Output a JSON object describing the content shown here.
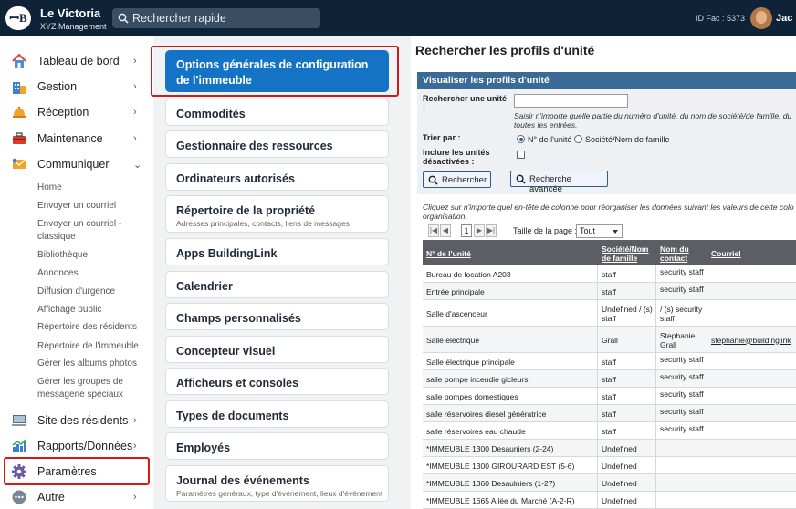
{
  "header": {
    "logo_text": "ꟷB",
    "building_name": "Le Victoria",
    "building_sub": "XYZ Management",
    "search_placeholder": "Rechercher rapide",
    "id_fac": "ID Fac : 5373",
    "user": "Jac"
  },
  "sidebar": {
    "items": [
      {
        "label": "Tableau de bord",
        "icon": "house-icon",
        "chev": "›"
      },
      {
        "label": "Gestion",
        "icon": "building-icon",
        "chev": "›"
      },
      {
        "label": "Réception",
        "icon": "bell-icon",
        "chev": "›"
      },
      {
        "label": "Maintenance",
        "icon": "toolbox-icon",
        "chev": "›"
      },
      {
        "label": "Communiquer",
        "icon": "envelope-icon",
        "chev": "⌄"
      },
      {
        "label": "Site des résidents",
        "icon": "monitor-icon",
        "chev": "›"
      },
      {
        "label": "Rapports/Données",
        "icon": "bar-chart-icon",
        "chev": "›"
      },
      {
        "label": "Paramètres",
        "icon": "gear-icon",
        "chev": ""
      },
      {
        "label": "Autre",
        "icon": "more-icon",
        "chev": "›"
      }
    ],
    "sub_items": [
      "Home",
      "Envoyer un courriel",
      "Envoyer un courriel - classique",
      "Bibliothèque",
      "Annonces",
      "Diffusion d'urgence",
      "Affichage public",
      "Répertoire des résidents",
      "Répertoire de l'immeuble",
      "Gérer les albums photos",
      "Gérer les groupes de messagerie spéciaux"
    ]
  },
  "cards": [
    {
      "title": "Options générales de configuration de l'immeuble",
      "sub": ""
    },
    {
      "title": "Commodités",
      "sub": ""
    },
    {
      "title": "Gestionnaire des ressources",
      "sub": ""
    },
    {
      "title": "Ordinateurs autorisés",
      "sub": ""
    },
    {
      "title": "Répertoire de la propriété",
      "sub": "Adresses principales, contacts, liens de messages"
    },
    {
      "title": "Apps BuildingLink",
      "sub": ""
    },
    {
      "title": "Calendrier",
      "sub": ""
    },
    {
      "title": "Champs personnalisés",
      "sub": ""
    },
    {
      "title": "Concepteur visuel",
      "sub": ""
    },
    {
      "title": "Afficheurs et consoles",
      "sub": ""
    },
    {
      "title": "Types de documents",
      "sub": ""
    },
    {
      "title": "Employés",
      "sub": ""
    },
    {
      "title": "Journal des événements",
      "sub": "Paramètres généraux, type d'événement, lieux d'événement"
    }
  ],
  "main": {
    "page_title": "Rechercher les profils d'unité",
    "panel_title": "Visualiser les profils d'unité",
    "search_label": "Rechercher une unité :",
    "search_value": "",
    "search_hint": "Saisir n'importe quelle partie du numéro d'unité, du nom de société/de famille, du toutes les entrées.",
    "sort_label": "Trier par :",
    "sort_option_1": "N° de l'unité",
    "sort_option_2": "Société/Nom de famille",
    "sort_selected": "N° de l'unité",
    "include_label": "Inclure les unités désactivées :",
    "include_checked": false,
    "search_button": "Rechercher",
    "adv_button": "Recherche avancée",
    "table_hint": "Cliquez sur n'importe quel en-tête de colonne pour réorganiser les données suivant les valeurs de cette colo organisation.",
    "page_number": "1",
    "page_size_label": "Taille de la page :",
    "page_size_value": "Tout",
    "pager_first": "|◀",
    "pager_prev": "◀",
    "pager_next": "▶",
    "pager_last": "▶|"
  },
  "table": {
    "headers": [
      "N° de l'unité",
      "Société/Nom de famille",
      "Nom du contact",
      "Courriel"
    ],
    "rows": [
      [
        "Bureau de location A203",
        "staff",
        "security staff",
        ""
      ],
      [
        "Entrée principale",
        "staff",
        "security staff",
        ""
      ],
      [
        "Salle d'ascenceur",
        "Undefined / (s) staff",
        "/ (s) security staff",
        ""
      ],
      [
        "Salle électrique",
        "Grall",
        "Stephanie Grall",
        "stephanie@buildinglink"
      ],
      [
        "Salle électrique principale",
        "staff",
        "security staff",
        ""
      ],
      [
        "salle pompe incendie gicleurs",
        "staff",
        "security staff",
        ""
      ],
      [
        "salle pompes domestiques",
        "staff",
        "security staff",
        ""
      ],
      [
        "salle réservoires diesel génératrice",
        "staff",
        "security staff",
        ""
      ],
      [
        "salle réservoires eau chaude",
        "staff",
        "security staff",
        ""
      ],
      [
        "*IMMEUBLE 1300 Desauniers (2-24)",
        "Undefined",
        "",
        ""
      ],
      [
        "*IMMEUBLE 1300 GIROURARD EST (5-6)",
        "Undefined",
        "",
        ""
      ],
      [
        "*IMMEUBLE 1360 Desaulniers (1-27)",
        "Undefined",
        "",
        ""
      ],
      [
        "*IMMEUBLE 1665 Allée du Marché (A-2-R)",
        "Undefined",
        "",
        ""
      ]
    ]
  },
  "colors": {
    "topbar": "#0e2338",
    "accent": "#1473c5",
    "highlight": "#d11b1b",
    "table_header": "#5b5f63",
    "panel_header": "#3a6a96"
  }
}
